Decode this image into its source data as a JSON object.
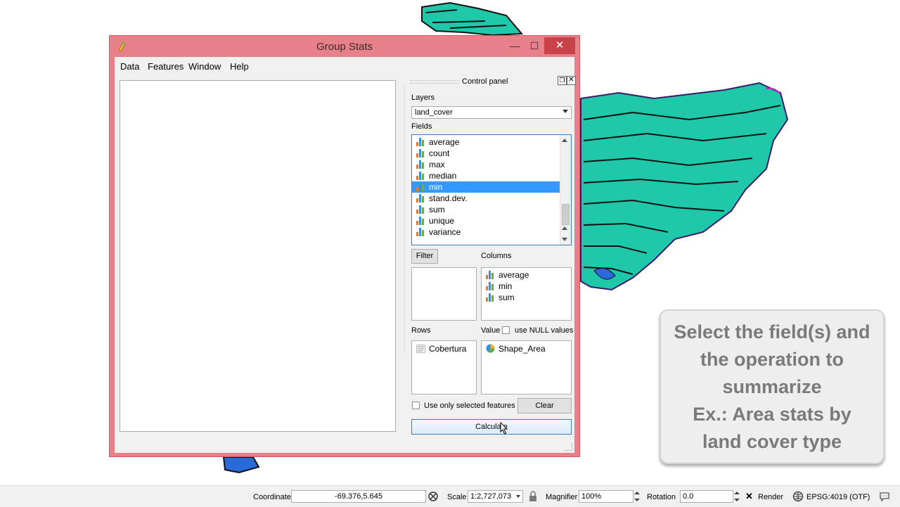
{
  "window": {
    "title": "Group Stats",
    "minimize": "—",
    "maximize": "☐",
    "close": "✕"
  },
  "menu": [
    "Data",
    "Features",
    "Window",
    "Help"
  ],
  "panel": {
    "title": "Control panel",
    "layers_label": "Layers",
    "layer_value": "land_cover",
    "fields_label": "Fields",
    "fields": [
      "average",
      "count",
      "max",
      "median",
      "min",
      "stand.dev.",
      "sum",
      "unique",
      "variance"
    ],
    "selected_field": "min",
    "filter_button": "Filter",
    "columns_label": "Columns",
    "columns": [
      "average",
      "min",
      "sum"
    ],
    "rows_label": "Rows",
    "rows": [
      "Cobertura"
    ],
    "value_label": "Value",
    "use_null_label": "use NULL values",
    "value_items": [
      "Shape_Area"
    ],
    "use_selected_label": "Use only selected features",
    "clear_button": "Clear",
    "calculate_button": "Calculate"
  },
  "callout": {
    "text": "Select the field(s) and\nthe operation to\nsummarize\nEx.: Area stats by\nland cover type"
  },
  "statusbar": {
    "coordinate_label": "Coordinate",
    "coordinate_value": "-69.376,5.645",
    "scale_label": "Scale",
    "scale_value": "1:2,727,073",
    "magnifier_label": "Magnifier",
    "magnifier_value": "100%",
    "rotation_label": "Rotation",
    "rotation_value": "0.0",
    "render_label": "Render",
    "crs_label": "EPSG:4019 (OTF)"
  },
  "colors": {
    "titlebar": "#e8808a",
    "close_button": "#c9424a",
    "selection": "#3399ff",
    "map_fill": "#1ec8a8",
    "callout_text": "#7a7a7a"
  }
}
